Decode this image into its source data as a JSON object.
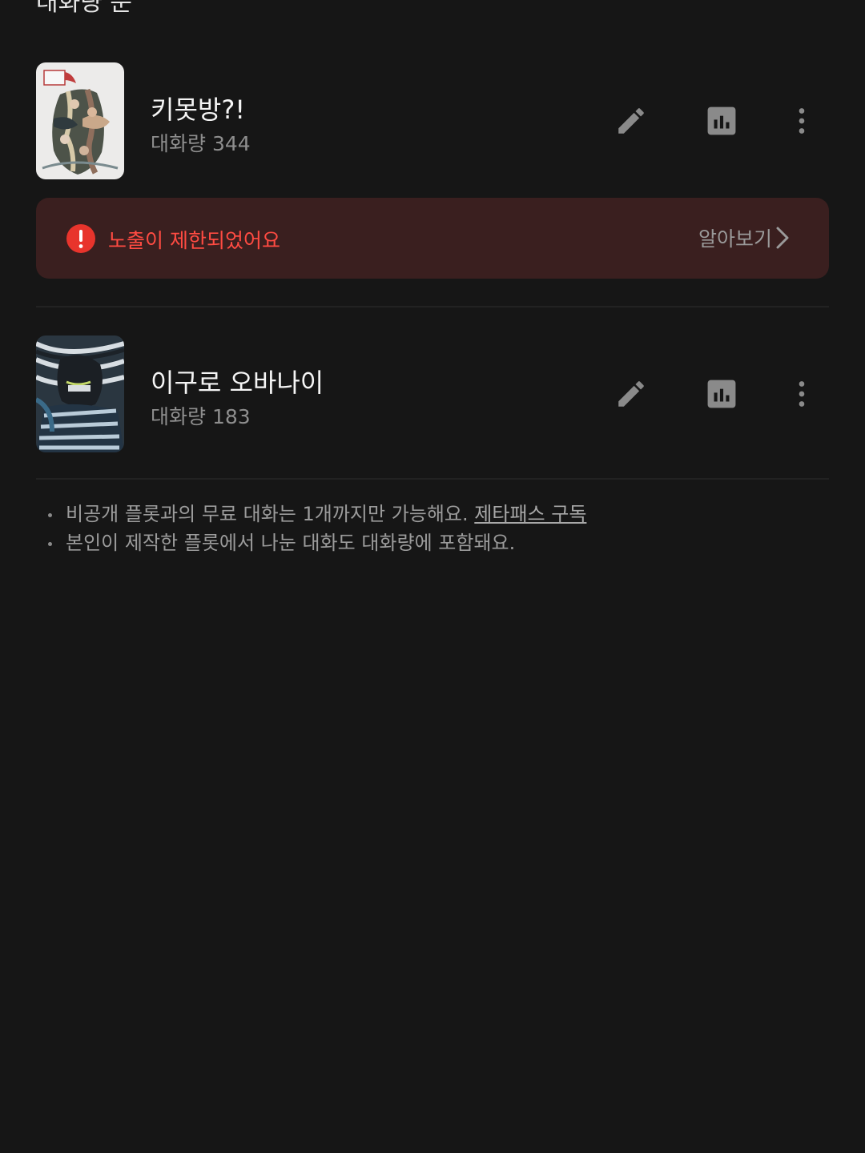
{
  "header": {
    "title_cut": "대화량 순"
  },
  "plots": [
    {
      "title": "키못방?!",
      "count": "대화량 344",
      "thumbnail": "anime-poster-thumbnail",
      "icons": {
        "edit": "pencil-icon",
        "stats": "bar-chart-icon",
        "more": "more-vertical-icon"
      }
    },
    {
      "title": "이구로 오바나이",
      "count": "대화량 183",
      "thumbnail": "character-thumbnail",
      "icons": {
        "edit": "pencil-icon",
        "stats": "bar-chart-icon",
        "more": "more-vertical-icon"
      }
    }
  ],
  "warning": {
    "text": "노출이 제한되었어요",
    "link": "알아보기",
    "colors": {
      "background": "#3a1f1f",
      "text": "#ff4b42",
      "icon": "#e8342c"
    }
  },
  "notes": {
    "line1": "비공개 플롯과의 무료 대화는 1개까지만 가능해요.",
    "line1_link": "제타패스 구독",
    "line2": "본인이 제작한 플롯에서 나눈 대화도 대화량에 포함돼요."
  },
  "colors": {
    "page_background": "#161616",
    "icon_gray": "#8a8a8a"
  }
}
